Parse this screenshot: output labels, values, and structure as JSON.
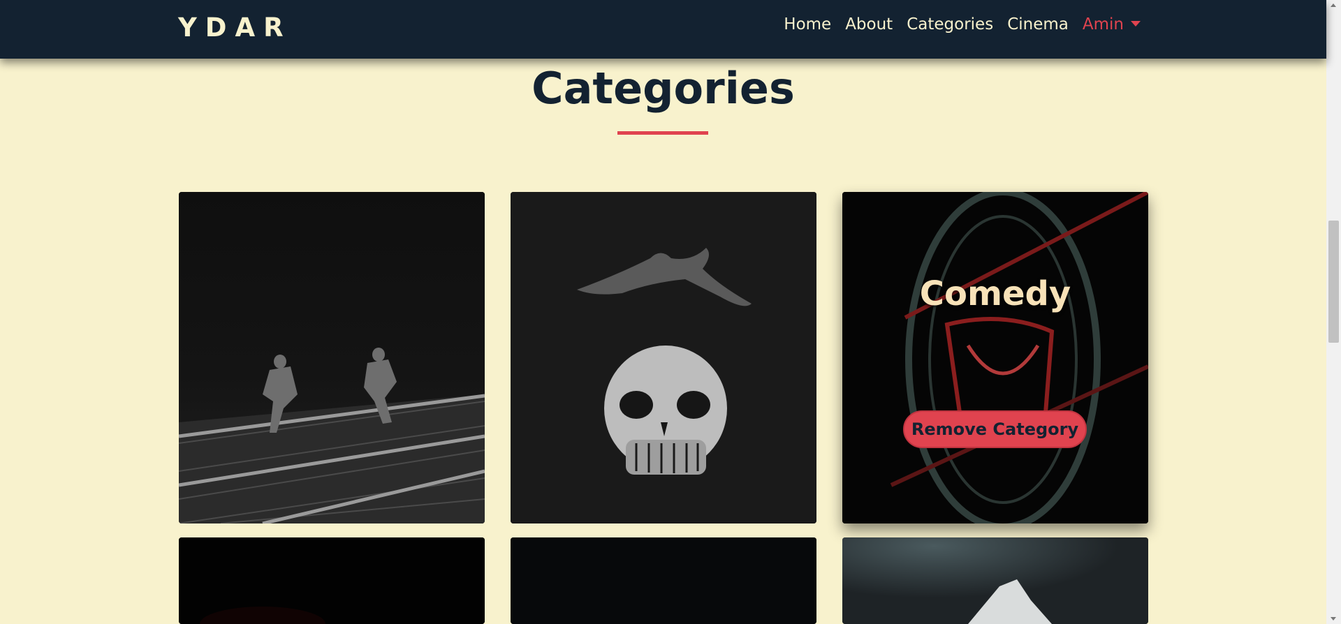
{
  "navbar": {
    "brand": "YDAR",
    "links": [
      "Home",
      "About",
      "Categories",
      "Cinema"
    ],
    "user": "Amin"
  },
  "page": {
    "title": "Categories"
  },
  "categories": [
    {
      "image": "sprinters-photo",
      "title": "",
      "action": ""
    },
    {
      "image": "skull-photo",
      "title": "",
      "action": ""
    },
    {
      "image": "comedy-neon-photo",
      "title": "Comedy",
      "action": "Remove Category"
    },
    {
      "image": "dark-photo",
      "title": "",
      "action": ""
    },
    {
      "image": "dark-photo",
      "title": "",
      "action": ""
    },
    {
      "image": "closeup-photo",
      "title": "",
      "action": ""
    }
  ],
  "colors": {
    "background": "#f8f2cd",
    "navbar": "#132231",
    "accent": "#e0434f"
  }
}
